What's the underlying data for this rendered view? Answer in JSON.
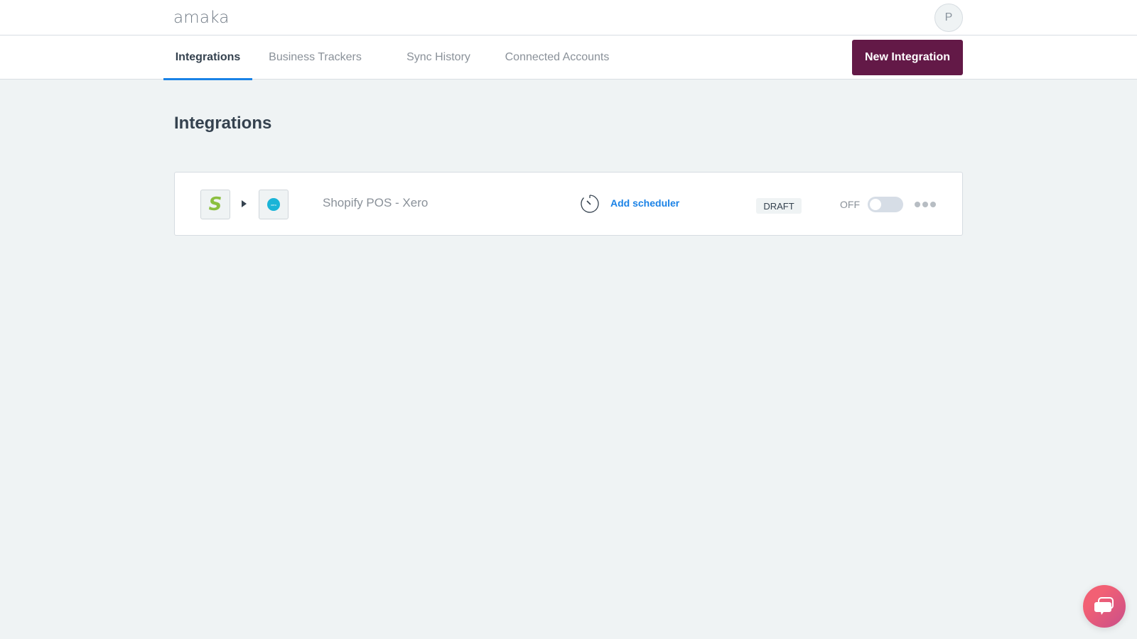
{
  "header": {
    "logo": "amaka",
    "avatar_initial": "P"
  },
  "nav": {
    "tabs": [
      {
        "label": "Integrations",
        "active": true
      },
      {
        "label": "Business Trackers",
        "active": false
      },
      {
        "label": "Sync History",
        "active": false
      },
      {
        "label": "Connected Accounts",
        "active": false
      }
    ],
    "new_integration_label": "New Integration"
  },
  "main": {
    "title": "Integrations",
    "integrations": [
      {
        "source_icon": "shopify-icon",
        "source_letter": "S",
        "target_icon": "xero-icon",
        "target_label": "xero",
        "name": "Shopify POS - Xero",
        "scheduler_link": "Add scheduler",
        "status": "DRAFT",
        "toggle_label": "OFF",
        "enabled": false
      }
    ]
  },
  "colors": {
    "brand": "#631947",
    "accent": "#1a82e6",
    "background": "#eff3f4",
    "shopify_green": "#8bbf3f",
    "xero_blue": "#1ab4d7"
  }
}
